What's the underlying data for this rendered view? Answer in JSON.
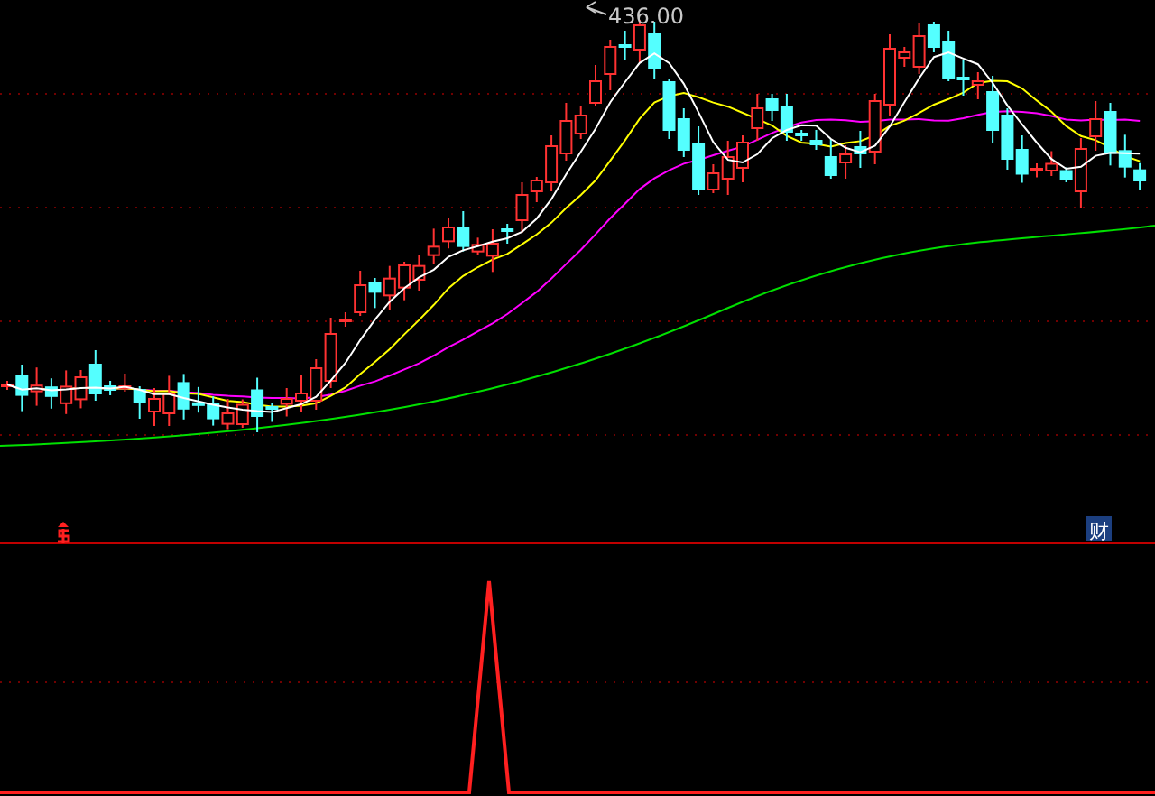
{
  "price_chart": {
    "peak_label": "436.00"
  },
  "event_badges": [
    {
      "kind": "finance",
      "text": "财"
    }
  ]
}
